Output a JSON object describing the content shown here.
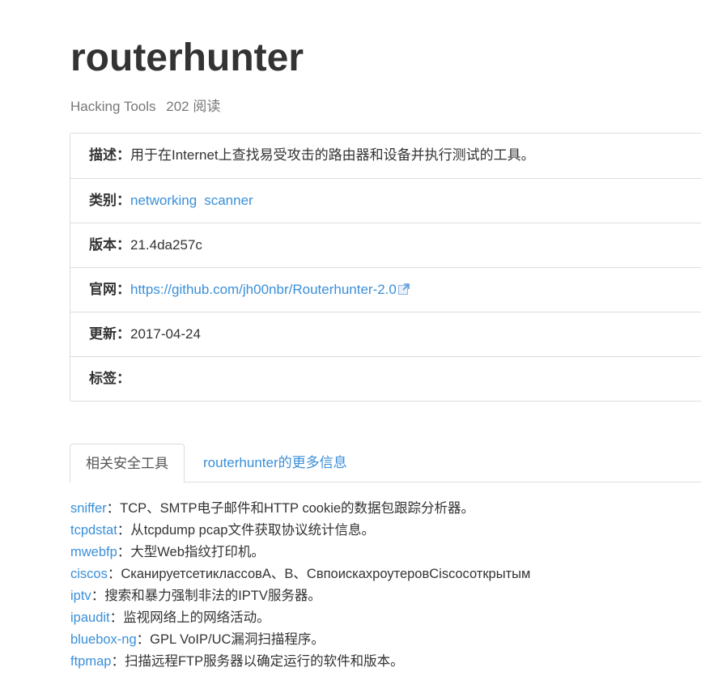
{
  "page": {
    "title": "routerhunter",
    "category": "Hacking Tools",
    "views": "202 阅读"
  },
  "info": {
    "description": {
      "label": "描述：",
      "value": "用于在Internet上查找易受攻击的路由器和设备并执行测试的工具。"
    },
    "category": {
      "label": "类别：",
      "tags": [
        "networking",
        "scanner"
      ]
    },
    "version": {
      "label": "版本：",
      "value": "21.4da257c"
    },
    "website": {
      "label": "官网：",
      "url": "https://github.com/jh00nbr/Routerhunter-2.0",
      "icon": "external-link-icon"
    },
    "updated": {
      "label": "更新：",
      "value": "2017-04-24"
    },
    "tags": {
      "label": "标签："
    }
  },
  "tabs": [
    {
      "label": "相关安全工具",
      "active": true
    },
    {
      "label": "routerhunter的更多信息",
      "active": false
    }
  ],
  "related_tools": [
    {
      "name": "sniffer",
      "desc": "：TCP、SMTP电子邮件和HTTP cookie的数据包跟踪分析器。"
    },
    {
      "name": "tcpdstat",
      "desc": "：从tcpdump pcap文件获取协议统计信息。"
    },
    {
      "name": "mwebfp",
      "desc": "：大型Web指纹打印机。"
    },
    {
      "name": "ciscos",
      "desc": "：СканируетсетиклассовA、B、СвпоискахроутеровCiscoсоткрытым"
    },
    {
      "name": "iptv",
      "desc": "：搜索和暴力强制非法的IPTV服务器。"
    },
    {
      "name": "ipaudit",
      "desc": "：监视网络上的网络活动。"
    },
    {
      "name": "bluebox-ng",
      "desc": "：GPL VoIP/UC漏洞扫描程序。"
    },
    {
      "name": "ftpmap",
      "desc": "：扫描远程FTP服务器以确定运行的软件和版本。"
    }
  ],
  "colors": {
    "link": "#3a8fd9",
    "text": "#333333",
    "muted": "#777777",
    "border": "#dddddd"
  }
}
